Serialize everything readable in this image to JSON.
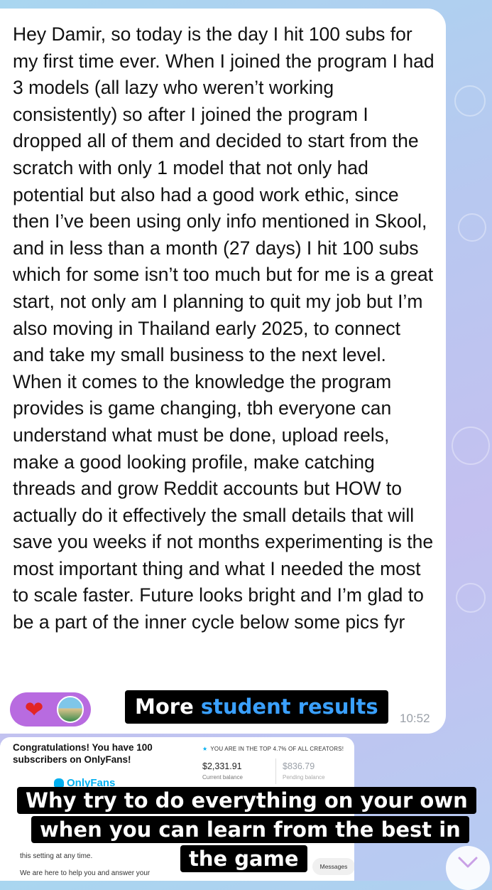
{
  "chat": {
    "message": {
      "text": "Hey Damir, so today is the day I hit 100 subs for my first time ever. When I joined the program I had 3 models (all lazy who weren’t working consistently) so after I joined the program I dropped all of them and decided to start from the scratch with only 1 model that not only had potential but also had a good work ethic, since then I’ve been using only info mentioned in Skool, and in less than a month (27 days) I hit 100 subs which for some isn’t too much but for me is a great start, not only am I planning to quit my job but I’m also moving in Thailand early 2025, to connect and take my small business to the next level. When it comes to the knowledge the program provides is game changing, tbh everyone can understand what must be done, upload reels, make a good looking profile, make catching threads and grow Reddit accounts but HOW to actually do it effectively the small details that will save you weeks if not months experimenting is the most important thing and what I needed the most to scale faster. Future looks bright and I’m glad to be a part of the inner cycle below some pics fyr",
      "time": "10:52",
      "reaction": "heart-icon"
    },
    "overlay_caption": {
      "prefix": "More",
      "accent": "student results",
      "accent_color": "#3aa0ff"
    },
    "photo": {
      "congrats": "Congratulations! You have 100 subscribers on OnlyFans!",
      "brand": "OnlyFans",
      "top_badge": "YOU ARE IN THE TOP 4.7% OF ALL CREATORS!",
      "current_balance": "$2,331.91",
      "current_label": "Current balance",
      "pending_balance": "$836.79",
      "pending_label": "Pending balance",
      "setting_text": "this setting at any time.",
      "help_text": "We are here to help you and answer your",
      "messages_button": "Messages"
    },
    "bottom_caption": {
      "line1": "Why try to do everything on your own",
      "line2": "when you can learn from the best in",
      "line3": "the game"
    }
  },
  "colors": {
    "reaction_pill": "#b86be0",
    "heart": "#e32525",
    "brand": "#00aff0"
  }
}
